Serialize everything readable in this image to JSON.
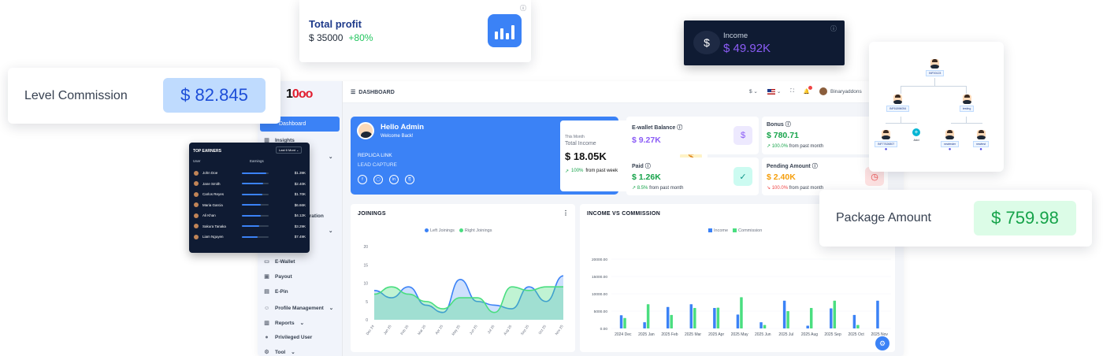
{
  "dashboard": {
    "header_title": "DASHBOARD",
    "currency_selector": "$",
    "username": "Binaryaddons",
    "logo_text_a": "1",
    "logo_text_b": "0",
    "logo_text_c": "oo",
    "sidebar": {
      "active": "Dashboard",
      "items": [
        "Insights",
        "E-Wallet",
        "Payout",
        "E-Pin",
        "Profile Management",
        "Reports",
        "Privileged User",
        "Tool"
      ],
      "partial_label": "stration"
    },
    "welcome": {
      "greeting": "Hello Admin",
      "sub": "Welcome Back!",
      "link1": "REPLICA LINK",
      "link2": "LEAD CAPTURE",
      "income_period": "This Month",
      "income_label": "Total Income",
      "income_value": "$ 18.05K",
      "income_change": "100%",
      "income_change_text": "from past week"
    },
    "stats": {
      "ewallet_label": "E-wallet Balance",
      "ewallet_value": "$ 9.27K",
      "bonus_label": "Bonus",
      "bonus_value": "$ 780.71",
      "bonus_change": "100.0%",
      "bonus_change_text": "from past month",
      "paid_label": "Paid",
      "paid_value": "$ 1.26K",
      "paid_change": "8.5%",
      "paid_change_text": "from past month",
      "pending_label": "Pending Amount",
      "pending_value": "$ 2.40K",
      "pending_change": "100.0%",
      "pending_change_text": "from past month"
    },
    "colors": {
      "primary": "#3b82f6",
      "green": "#4ade80",
      "purple": "#8b5cf6",
      "orange": "#f59e0b"
    }
  },
  "floating": {
    "total_profit": {
      "title": "Total profit",
      "value": "$ 35000",
      "change": "+80%"
    },
    "income": {
      "title": "Income",
      "value": "$ 49.92K"
    },
    "level_commission": {
      "title": "Level Commission",
      "value": "$ 82.845"
    },
    "package_amount": {
      "title": "Package Amount",
      "value": "$ 759.98"
    }
  },
  "top_earners": {
    "title": "TOP EARNERS",
    "filter": "Last 6 Mont",
    "col_user": "User",
    "col_earnings": "Earnings",
    "rows": [
      {
        "name": "John Doe",
        "amount": "$1.39K",
        "fill": 0.9
      },
      {
        "name": "Jane Smith",
        "amount": "$2.40K",
        "fill": 0.8
      },
      {
        "name": "Carlos Reyes",
        "amount": "$1.70K",
        "fill": 0.75
      },
      {
        "name": "Maria Garcia",
        "amount": "$6.66K",
        "fill": 0.7
      },
      {
        "name": "Ali Khan",
        "amount": "$4.12K",
        "fill": 0.7
      },
      {
        "name": "Sakura Tanaka",
        "amount": "$3.29K",
        "fill": 0.65
      },
      {
        "name": "Liam Nguyen",
        "amount": "$7.49K",
        "fill": 0.6
      }
    ]
  },
  "genealogy": {
    "root": "INF00123",
    "left": "INF61896054",
    "right": "testing",
    "ll": "INF77626807",
    "add_label": "Add",
    "rl": "newtester",
    "rr": "newtest"
  },
  "chart_data": [
    {
      "type": "area",
      "title": "JOININGS",
      "categories": [
        "Dec 24",
        "Jan 25",
        "Feb 25",
        "Mar 25",
        "Apr 25",
        "May 25",
        "Jun 25",
        "Jul 25",
        "Aug 25",
        "Sep 25",
        "Oct 25",
        "Nov 25"
      ],
      "series": [
        {
          "name": "Left Joinings",
          "values": [
            8,
            6,
            9,
            4,
            2,
            11,
            5,
            4,
            3,
            9,
            5,
            12
          ],
          "color": "#3b82f6"
        },
        {
          "name": "Right Joinings",
          "values": [
            7,
            9,
            7,
            5,
            3,
            6,
            6,
            2,
            9,
            8,
            9,
            9
          ],
          "color": "#4ade80"
        }
      ],
      "y_ticks": [
        "0",
        "5",
        "10",
        "15",
        "20"
      ],
      "ylim": [
        0,
        20
      ]
    },
    {
      "type": "bar",
      "title": "INCOME VS COMMISSION",
      "categories": [
        "2024 Dec",
        "2025 Jan",
        "2025 Feb",
        "2025 Mar",
        "2025 Apr",
        "2025 May",
        "2025 Jun",
        "2025 Jul",
        "2025 Aug",
        "2025 Sep",
        "2025 Oct",
        "2025 Nov"
      ],
      "series": [
        {
          "name": "Income",
          "values": [
            3800,
            1800,
            6200,
            7000,
            5900,
            4000,
            1800,
            8000,
            800,
            5800,
            3900,
            8000
          ],
          "color": "#3b82f6"
        },
        {
          "name": "Commission",
          "values": [
            3000,
            7000,
            3900,
            5900,
            6000,
            9000,
            1000,
            5000,
            5900,
            8000,
            1000,
            0
          ],
          "color": "#4ade80"
        }
      ],
      "y_ticks": [
        "0.00",
        "5000.00",
        "10000.00",
        "15000.00",
        "20000.00"
      ],
      "ylim": [
        0,
        20000
      ]
    }
  ]
}
